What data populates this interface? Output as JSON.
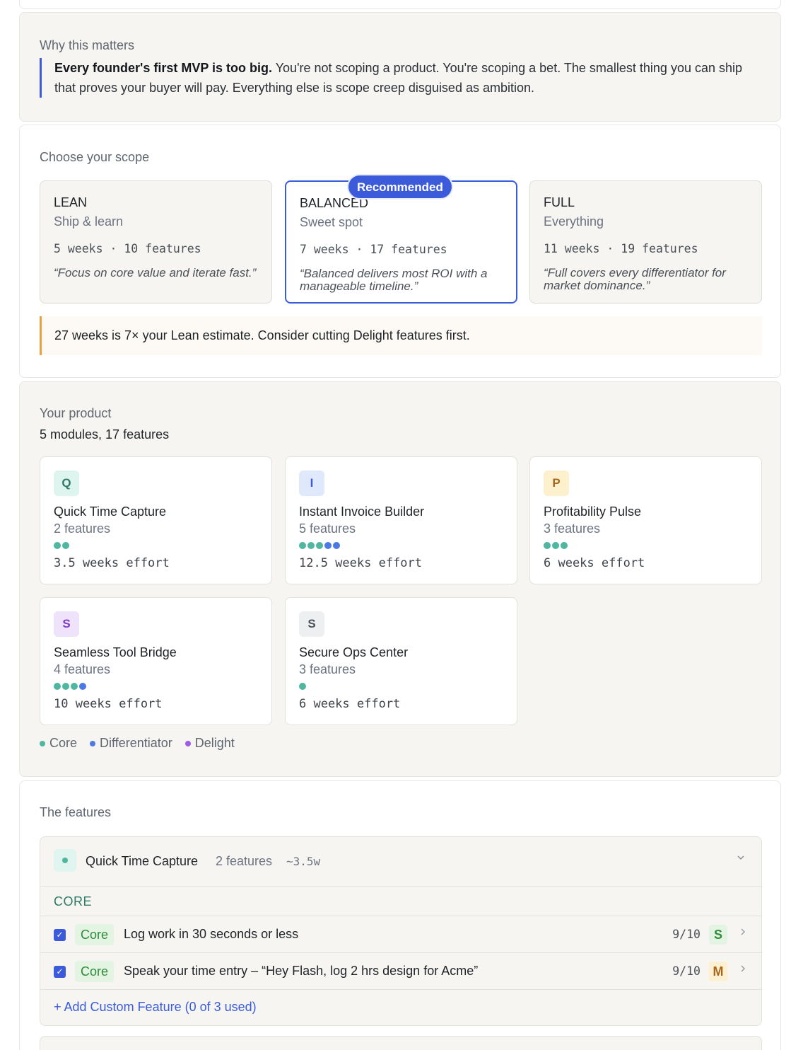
{
  "why": {
    "label": "Why this matters",
    "lead": "Every founder's first MVP is too big.",
    "body": " You're not scoping a product. You're scoping a bet. The smallest thing you can ship that proves your buyer will pay. Everything else is scope creep disguised as ambition."
  },
  "scope": {
    "label": "Choose your scope",
    "recommended_badge": "Recommended",
    "options": [
      {
        "name": "LEAN",
        "sub": "Ship & learn",
        "meta": "5 weeks · 10 features",
        "quote": "“Focus on core value and iterate fast.”"
      },
      {
        "name": "BALANCED",
        "sub": "Sweet spot",
        "meta": "7 weeks · 17 features",
        "quote": "“Balanced delivers most ROI with a manageable timeline.”"
      },
      {
        "name": "FULL",
        "sub": "Everything",
        "meta": "11 weeks · 19 features",
        "quote": "“Full covers every differentiator for market dominance.”"
      }
    ],
    "warning": "27 weeks is 7× your Lean estimate. Consider cutting Delight features first."
  },
  "product": {
    "label": "Your product",
    "summary": "5 modules, 17 features",
    "modules": [
      {
        "letter": "Q",
        "name": "Quick Time Capture",
        "count": "2 features",
        "effort": "3.5 weeks effort"
      },
      {
        "letter": "I",
        "name": "Instant Invoice Builder",
        "count": "5 features",
        "effort": "12.5 weeks effort"
      },
      {
        "letter": "P",
        "name": "Profitability Pulse",
        "count": "3 features",
        "effort": "6 weeks effort"
      },
      {
        "letter": "S",
        "name": "Seamless Tool Bridge",
        "count": "4 features",
        "effort": "10 weeks effort"
      },
      {
        "letter": "S",
        "name": "Secure Ops Center",
        "count": "3 features",
        "effort": "6 weeks effort"
      }
    ],
    "legend": {
      "core": "Core",
      "differentiator": "Differentiator",
      "delight": "Delight"
    },
    "colors": {
      "core": "#4fb6a0",
      "differentiator": "#4c79e3",
      "delight": "#9b5de5"
    }
  },
  "features": {
    "label": "The features",
    "group": {
      "name": "Quick Time Capture",
      "count": "2 features",
      "effort": "~3.5w",
      "category": "CORE",
      "rows": [
        {
          "tag": "Core",
          "text": "Log work in 30 seconds or less",
          "score": "9/10",
          "size": "S"
        },
        {
          "tag": "Core",
          "text": "Speak your time entry – “Hey Flash, log 2 hrs design for Acme”",
          "score": "9/10",
          "size": "M"
        }
      ],
      "add_label": "+ Add Custom Feature (0 of 3 used)"
    }
  }
}
